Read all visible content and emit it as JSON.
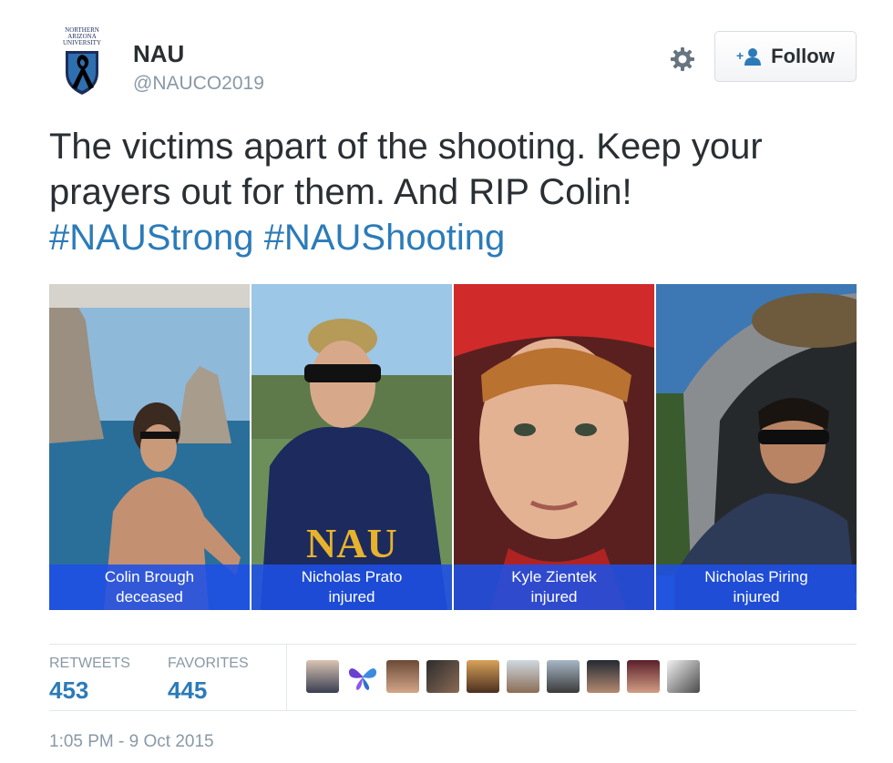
{
  "account": {
    "logo_text": "NORTHERN ARIZONA UNIVERSITY",
    "name": "NAU",
    "handle": "@NAUCO2019"
  },
  "actions": {
    "follow_label": "Follow",
    "settings_icon": "gear-icon",
    "follow_icon": "add-user-icon"
  },
  "tweet": {
    "text_line1": "The victims apart of the shooting. Keep your",
    "text_line2": "prayers out for them. And RIP Colin!",
    "hashtags": [
      "#NAUStrong",
      "#NAUShooting"
    ]
  },
  "media": {
    "panels": [
      {
        "name": "Colin Brough",
        "status": "deceased"
      },
      {
        "name": "Nicholas Prato",
        "status": "injured"
      },
      {
        "name": "Kyle Zientek",
        "status": "injured"
      },
      {
        "name": "Nicholas Piring",
        "status": "injured"
      }
    ],
    "hoodie_text": "NAU"
  },
  "stats": {
    "retweets_label": "RETWEETS",
    "retweets_value": "453",
    "favorites_label": "FAVORITES",
    "favorites_value": "445"
  },
  "favoriters_count_shown": 10,
  "timestamp": "1:05 PM - 9 Oct 2015",
  "colors": {
    "link": "#2b7bb9",
    "text": "#292f33",
    "muted": "#8899a6",
    "caption_bg": "#1e50e6"
  }
}
